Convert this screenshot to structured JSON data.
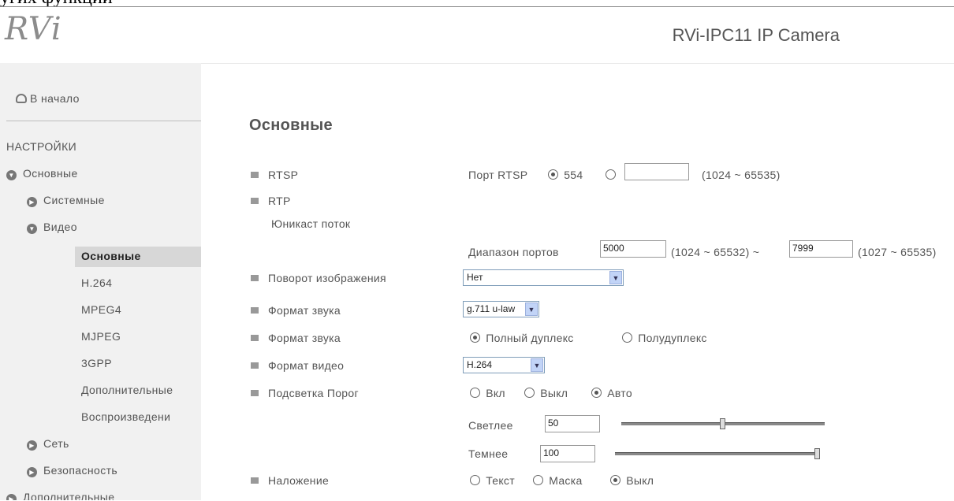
{
  "cut_text": "угих функций",
  "logo": "RVi",
  "title": "RVi-IPC11 IP Camera",
  "sidebar": {
    "home": "В начало",
    "section": "НАСТРОЙКИ",
    "items": [
      {
        "label": "Основные"
      },
      {
        "label": "Системные"
      },
      {
        "label": "Видео"
      },
      {
        "label": "Основные"
      },
      {
        "label": "H.264"
      },
      {
        "label": "MPEG4"
      },
      {
        "label": "MJPEG"
      },
      {
        "label": "3GPP"
      },
      {
        "label": "Дополнительные"
      },
      {
        "label": "Воспроизведени"
      },
      {
        "label": "Сеть"
      },
      {
        "label": "Безопасность"
      },
      {
        "label": "Дополнительные"
      }
    ]
  },
  "page": {
    "heading": "Основные",
    "rows": {
      "rtsp": "RTSP",
      "rtp": "RTP",
      "unicast": "Юникаст поток",
      "rotate": "Поворот изображения",
      "audio_format": "Формат звука",
      "audio_mode": "Формат звука",
      "video_format": "Формат видео",
      "backlight": "Подсветка Порог",
      "overlay": "Наложение"
    },
    "rtsp_port_label": "Порт RTSP",
    "rtsp_default": "554",
    "rtsp_custom_value": "",
    "rtsp_range": "(1024 ~ 65535)",
    "port_range_label": "Диапазон портов",
    "port_from": "5000",
    "port_from_range": "(1024 ~ 65532) ~",
    "port_to": "7999",
    "port_to_range": "(1027 ~ 65535)",
    "rotate_value": "Нет",
    "audio_value": "g.711 u-law",
    "full_duplex": "Полный дуплекс",
    "half_duplex": "Полудуплекс",
    "video_value": "H.264",
    "on": "Вкл",
    "off": "Выкл",
    "auto": "Авто",
    "brighter_label": "Светлее",
    "brighter_value": "50",
    "darker_label": "Темнее",
    "darker_value": "100",
    "overlay_text": "Текст",
    "overlay_mask": "Маска",
    "overlay_off": "Выкл"
  }
}
